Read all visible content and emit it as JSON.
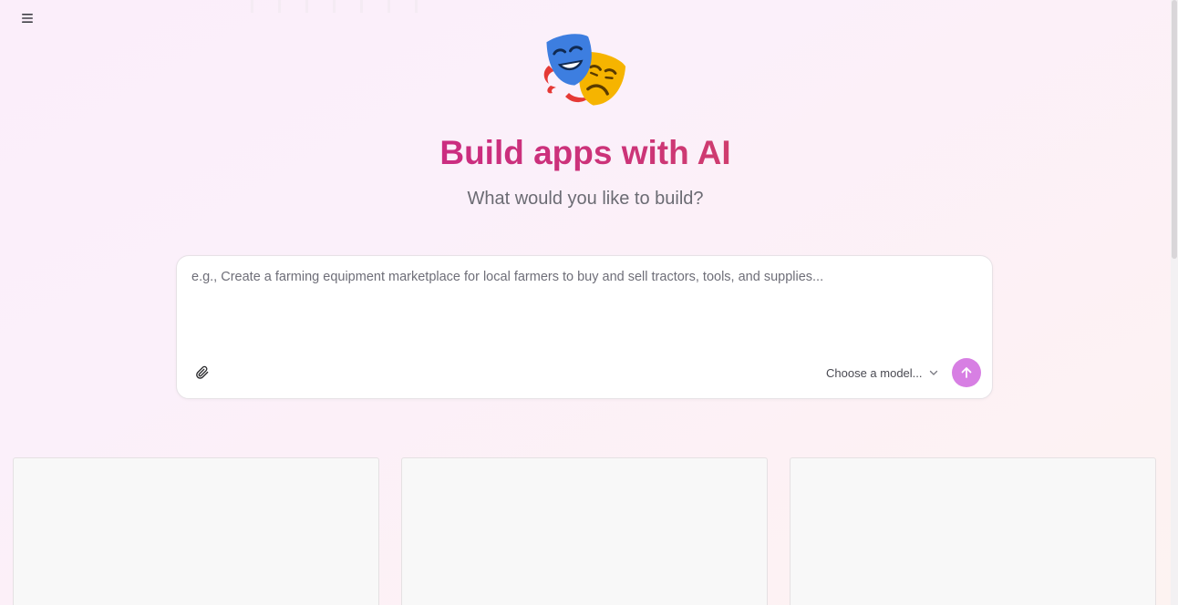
{
  "header": {
    "menu_icon": "hamburger-menu-icon"
  },
  "hero": {
    "icon": "performing-arts-masks-icon",
    "title": "Build apps with AI",
    "subtitle": "What would you like to build?"
  },
  "prompt": {
    "placeholder": "e.g., Create a farming equipment marketplace for local farmers to buy and sell tractors, tools, and supplies...",
    "value": "",
    "attach_icon": "paperclip-icon",
    "model_select_label": "Choose a model...",
    "model_chevron_icon": "chevron-down-icon",
    "send_icon": "arrow-up-icon",
    "send_color": "#d77fe3"
  },
  "colors": {
    "title_gradient_start": "#c81a94",
    "title_gradient_end": "#de6540",
    "subtitle": "#6b6b73"
  },
  "cards": [
    {
      "id": "card-1"
    },
    {
      "id": "card-2"
    },
    {
      "id": "card-3"
    }
  ]
}
